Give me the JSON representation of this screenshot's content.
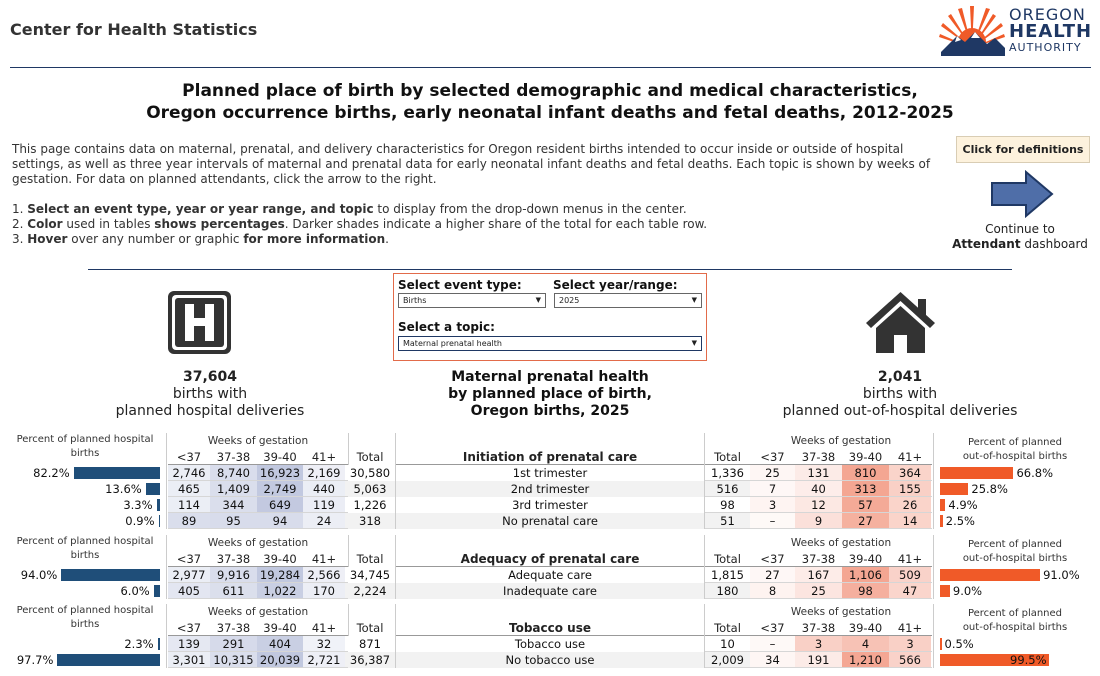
{
  "header": {
    "org_name": "Center for Health Statistics",
    "logo": {
      "line1": "OREGON",
      "line2": "HEALTH",
      "line3": "AUTHORITY"
    }
  },
  "title": {
    "line1": "Planned place of birth by selected demographic and medical characteristics,",
    "line2": "Oregon occurrence births, early neonatal infant deaths and fetal deaths, 2012-2025"
  },
  "intro": "This page contains data on maternal, prenatal, and delivery characteristics for Oregon resident births intended to occur inside or outside of hospital settings, as well as three year intervals of maternal and prenatal data for early neonatal infant deaths and fetal deaths. Each topic is shown by weeks of gestation. For data on planned attendants, click the arrow to the right.",
  "steps": [
    {
      "num": "1. ",
      "bold1": "Select an event type, year or year range, and topic",
      "rest1": " to display from the drop-down menus in the center."
    },
    {
      "num": "2. ",
      "bold1": "Color",
      "rest1": " used in tables ",
      "bold2": "shows percentages",
      "rest2": ". Darker shades indicate a higher share of the total for each table row."
    },
    {
      "num": "3. ",
      "bold1": "Hover",
      "rest1": " over any number or graphic ",
      "bold2": "for more information",
      "rest2": "."
    }
  ],
  "definitions_button": "Click for definitions",
  "continue": {
    "line1": "Continue to",
    "bold": "Attendant",
    "rest": " dashboard"
  },
  "selectors": {
    "event_label": "Select event type:",
    "event_value": "Births",
    "year_label": "Select year/range:",
    "year_value": "2025",
    "topic_label": "Select a topic:",
    "topic_value": "Maternal prenatal health"
  },
  "icons": {
    "hospital": "hospital-icon",
    "home": "home-icon",
    "arrow": "right-arrow-icon",
    "caret": "chevron-down-icon"
  },
  "colors": {
    "navy": "#1f3864",
    "hospital_bar": "#1f4e79",
    "home_bar": "#f05a28",
    "selector_border": "#e26b4a"
  },
  "left_summary": {
    "count": "37,604",
    "line2": "births with",
    "line3": "planned hospital deliveries"
  },
  "right_summary": {
    "count": "2,041",
    "line2": "births with",
    "line3": "planned out-of-hospital deliveries"
  },
  "center_heading": {
    "line1": "Maternal prenatal health",
    "line2": "by planned place of birth,",
    "line3": "Oregon births, 2025"
  },
  "labels": {
    "left_pct_caption_1": "Percent of planned hospital",
    "left_pct_caption_2": "births",
    "right_pct_caption_1": "Percent of planned",
    "right_pct_caption_2": "out-of-hospital births",
    "weeks": "Weeks of gestation",
    "cols": [
      "<37",
      "37-38",
      "39-40",
      "41+"
    ],
    "total": "Total"
  },
  "sections": [
    {
      "title": "Initiation of prenatal care",
      "rows": [
        {
          "label": "1st trimester",
          "left_pct": "82.2%",
          "left_pct_val": 82.2,
          "left": [
            "2,746",
            "8,740",
            "16,923",
            "2,169"
          ],
          "left_total": "30,580",
          "left_shade": [
            0.09,
            0.29,
            0.55,
            0.07
          ],
          "right_total": "1,336",
          "right": [
            "25",
            "131",
            "810",
            "364"
          ],
          "right_shade": [
            0.02,
            0.1,
            0.61,
            0.27
          ],
          "right_pct": "66.8%",
          "right_pct_val": 66.8
        },
        {
          "label": "2nd trimester",
          "left_pct": "13.6%",
          "left_pct_val": 13.6,
          "left": [
            "465",
            "1,409",
            "2,749",
            "440"
          ],
          "left_total": "5,063",
          "left_shade": [
            0.09,
            0.28,
            0.54,
            0.09
          ],
          "right_total": "516",
          "right": [
            "7",
            "40",
            "313",
            "155"
          ],
          "right_shade": [
            0.01,
            0.08,
            0.61,
            0.3
          ],
          "right_pct": "25.8%",
          "right_pct_val": 25.8
        },
        {
          "label": "3rd trimester",
          "left_pct": "3.3%",
          "left_pct_val": 3.3,
          "left": [
            "114",
            "344",
            "649",
            "119"
          ],
          "left_total": "1,226",
          "left_shade": [
            0.09,
            0.28,
            0.53,
            0.1
          ],
          "right_total": "98",
          "right": [
            "3",
            "12",
            "57",
            "26"
          ],
          "right_shade": [
            0.03,
            0.12,
            0.58,
            0.27
          ],
          "right_pct": "4.9%",
          "right_pct_val": 4.9
        },
        {
          "label": "No prenatal care",
          "left_pct": "0.9%",
          "left_pct_val": 0.9,
          "left": [
            "89",
            "95",
            "94",
            "24"
          ],
          "left_total": "318",
          "left_shade": [
            0.28,
            0.3,
            0.3,
            0.08
          ],
          "right_total": "51",
          "right": [
            "–",
            "9",
            "27",
            "14"
          ],
          "right_shade": [
            0,
            0.18,
            0.53,
            0.27
          ],
          "right_pct": "2.5%",
          "right_pct_val": 2.5
        }
      ]
    },
    {
      "title": "Adequacy of prenatal care",
      "rows": [
        {
          "label": "Adequate care",
          "left_pct": "94.0%",
          "left_pct_val": 94.0,
          "left": [
            "2,977",
            "9,916",
            "19,284",
            "2,566"
          ],
          "left_total": "34,745",
          "left_shade": [
            0.09,
            0.29,
            0.55,
            0.07
          ],
          "right_total": "1,815",
          "right": [
            "27",
            "167",
            "1,106",
            "509"
          ],
          "right_shade": [
            0.01,
            0.09,
            0.61,
            0.28
          ],
          "right_pct": "91.0%",
          "right_pct_val": 91.0
        },
        {
          "label": "Inadequate care",
          "left_pct": "6.0%",
          "left_pct_val": 6.0,
          "left": [
            "405",
            "611",
            "1,022",
            "170"
          ],
          "left_total": "2,224",
          "left_shade": [
            0.18,
            0.27,
            0.46,
            0.08
          ],
          "right_total": "180",
          "right": [
            "8",
            "25",
            "98",
            "47"
          ],
          "right_shade": [
            0.04,
            0.14,
            0.54,
            0.26
          ],
          "right_pct": "9.0%",
          "right_pct_val": 9.0
        }
      ]
    },
    {
      "title": "Tobacco use",
      "rows": [
        {
          "label": "Tobacco use",
          "left_pct": "2.3%",
          "left_pct_val": 2.3,
          "left": [
            "139",
            "291",
            "404",
            "32"
          ],
          "left_total": "871",
          "left_shade": [
            0.16,
            0.33,
            0.46,
            0.04
          ],
          "right_total": "10",
          "right": [
            "–",
            "3",
            "4",
            "3"
          ],
          "right_shade": [
            0,
            0.3,
            0.4,
            0.3
          ],
          "right_pct": "0.5%",
          "right_pct_val": 0.5
        },
        {
          "label": "No tobacco use",
          "left_pct": "97.7%",
          "left_pct_val": 97.7,
          "left": [
            "3,301",
            "10,315",
            "20,039",
            "2,721"
          ],
          "left_total": "36,387",
          "left_shade": [
            0.09,
            0.28,
            0.55,
            0.07
          ],
          "right_total": "2,009",
          "right": [
            "34",
            "191",
            "1,210",
            "566"
          ],
          "right_shade": [
            0.02,
            0.1,
            0.6,
            0.28
          ],
          "right_pct": "99.5%",
          "right_pct_val": 99.5
        }
      ]
    }
  ]
}
